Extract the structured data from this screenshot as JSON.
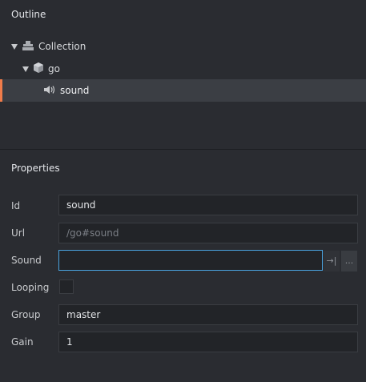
{
  "outline": {
    "title": "Outline",
    "items": [
      {
        "label": "Collection",
        "icon": "collection-icon"
      },
      {
        "label": "go",
        "icon": "game-object-icon"
      },
      {
        "label": "sound",
        "icon": "sound-icon"
      }
    ],
    "selected": "sound"
  },
  "properties": {
    "title": "Properties",
    "id": {
      "label": "Id",
      "value": "sound"
    },
    "url": {
      "label": "Url",
      "placeholder": "/go#sound"
    },
    "sound": {
      "label": "Sound",
      "value": "",
      "clear_icon": "→|",
      "browse_label": "..."
    },
    "looping": {
      "label": "Looping",
      "checked": false
    },
    "group": {
      "label": "Group",
      "value": "master"
    },
    "gain": {
      "label": "Gain",
      "value": "1"
    }
  },
  "colors": {
    "selection_accent": "#f07c4a",
    "focus_border": "#4aa3df",
    "panel_bg": "#2a2c31",
    "field_bg": "#222428"
  }
}
